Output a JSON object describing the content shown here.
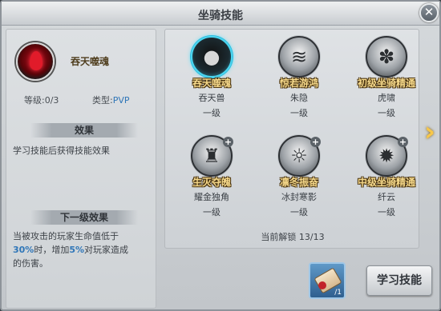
{
  "window": {
    "title": "坐骑技能"
  },
  "selected": {
    "name": "吞天噬魂",
    "level_label": "等级:",
    "level_value": "0/3",
    "type_label": "类型:",
    "type_value": "PVP",
    "effect_header": "效果",
    "effect_text": "学习技能后获得技能效果",
    "next_header": "下一级效果",
    "next_text_1": "当被攻击的玩家生命值低于",
    "next_pct_1": "30%",
    "next_text_2": "时，增加",
    "next_pct_2": "5%",
    "next_text_3": "对玩家造成",
    "next_text_4": "的伤害。"
  },
  "skills": [
    {
      "name": "吞天噬魂",
      "source": "吞天兽",
      "level": "一级",
      "icon": "dark-drop-icon",
      "glyph": "●"
    },
    {
      "name": "惊若游鸿",
      "source": "朱隐",
      "level": "一级",
      "icon": "wind-rider-icon",
      "glyph": "≋"
    },
    {
      "name": "初级坐骑精通",
      "source": "虎啸",
      "level": "一级",
      "icon": "paw-icon",
      "glyph": "✽"
    },
    {
      "name": "生灭夺魄",
      "source": "耀金独角",
      "level": "一级",
      "icon": "warrior-icon",
      "glyph": "♜"
    },
    {
      "name": "凛冬振奋",
      "source": "冰封寒影",
      "level": "一级",
      "icon": "roar-icon",
      "glyph": "☼"
    },
    {
      "name": "中级坐骑精通",
      "source": "纤云",
      "level": "一级",
      "icon": "wolf-icon",
      "glyph": "✹"
    }
  ],
  "unlock": {
    "label": "当前解锁",
    "value": "13/13"
  },
  "scroll_item": {
    "icon": "scroll-icon",
    "count": "/1"
  },
  "buttons": {
    "learn": "学习技能",
    "close": "✕",
    "next": "›"
  }
}
